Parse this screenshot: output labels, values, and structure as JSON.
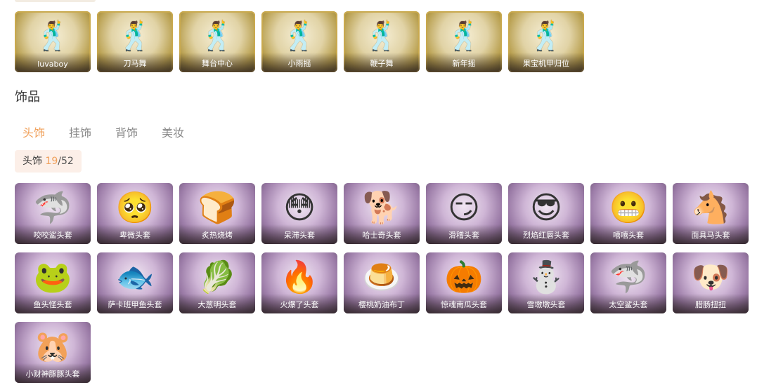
{
  "emotes": [
    {
      "name": "luvaboy",
      "icon": "dance-pose-icon"
    },
    {
      "name": "刀马舞",
      "icon": "dance-pose-icon"
    },
    {
      "name": "舞台中心",
      "icon": "dance-pose-icon"
    },
    {
      "name": "小雨摇",
      "icon": "dance-pose-icon"
    },
    {
      "name": "鞭子舞",
      "icon": "dance-pose-icon"
    },
    {
      "name": "新年摇",
      "icon": "dance-pose-icon"
    },
    {
      "name": "果宝机甲归位",
      "icon": "dance-pose-icon"
    }
  ],
  "section": {
    "title": "饰品"
  },
  "tabs": [
    {
      "label": "头饰",
      "active": true
    },
    {
      "label": "挂饰",
      "active": false
    },
    {
      "label": "背饰",
      "active": false
    },
    {
      "label": "美妆",
      "active": false
    }
  ],
  "counter": {
    "label": "头饰",
    "owned": "19",
    "separator": "/",
    "total": "52"
  },
  "accessories": [
    {
      "name": "咬咬鲨头套",
      "icon": "shark-icon",
      "glyph": "🦈"
    },
    {
      "name": "卑微头套",
      "icon": "worried-face-icon",
      "glyph": "🥺"
    },
    {
      "name": "炙热烧烤",
      "icon": "toast-face-icon",
      "glyph": "🍞"
    },
    {
      "name": "呆滞头套",
      "icon": "dazed-face-icon",
      "glyph": "😳"
    },
    {
      "name": "哈士奇头套",
      "icon": "husky-icon",
      "glyph": "🐕"
    },
    {
      "name": "滑稽头套",
      "icon": "smirk-face-icon",
      "glyph": "😏"
    },
    {
      "name": "烈焰红唇头套",
      "icon": "pikachu-icon",
      "glyph": "😎"
    },
    {
      "name": "嘻嘻头套",
      "icon": "grin-face-icon",
      "glyph": "😬"
    },
    {
      "name": "面具马头套",
      "icon": "horse-icon",
      "glyph": "🐴"
    },
    {
      "name": "鱼头怪头套",
      "icon": "fish-monster-icon",
      "glyph": "🐸"
    },
    {
      "name": "萨卡班甲鱼头套",
      "icon": "fish-icon",
      "glyph": "🐟"
    },
    {
      "name": "大葱明头套",
      "icon": "scallion-icon",
      "glyph": "🥬"
    },
    {
      "name": "火爆了头套",
      "icon": "fire-icon",
      "glyph": "🔥"
    },
    {
      "name": "樱桃奶油布丁",
      "icon": "pudding-icon",
      "glyph": "🍮"
    },
    {
      "name": "惊魂南瓜头套",
      "icon": "pumpkin-icon",
      "glyph": "🎃"
    },
    {
      "name": "雪墩墩头套",
      "icon": "snowman-icon",
      "glyph": "⛄"
    },
    {
      "name": "太空鲨头套",
      "icon": "space-shark-icon",
      "glyph": "🦈"
    },
    {
      "name": "腊肠扭扭",
      "icon": "dachshund-icon",
      "glyph": "🐶"
    },
    {
      "name": "小财神豚豚头套",
      "icon": "capybara-icon",
      "glyph": "🐹"
    }
  ]
}
